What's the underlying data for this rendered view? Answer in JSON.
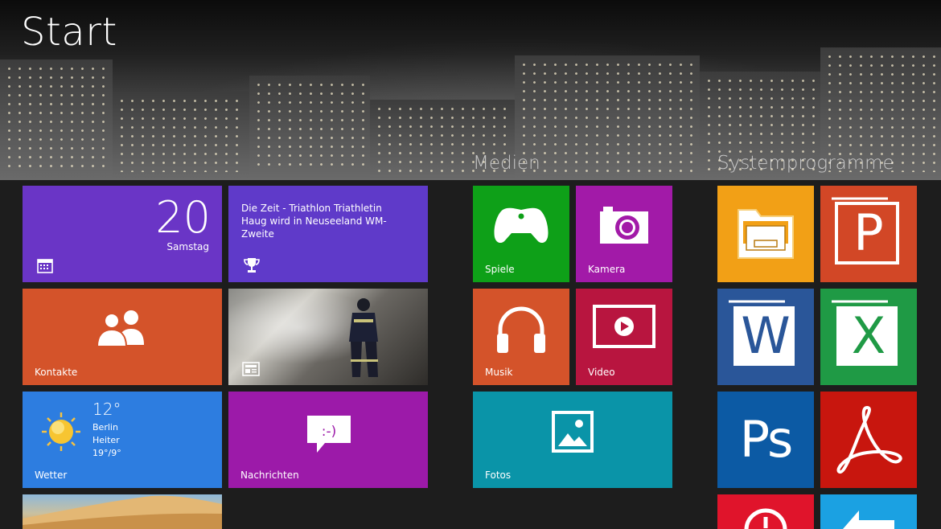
{
  "title": "Start",
  "groups": {
    "media": "Medien",
    "system": "Systemprogramme"
  },
  "tiles": {
    "calendar": {
      "day": "20",
      "weekday": "Samstag",
      "color": "#6a35c6"
    },
    "news_headline": "Die Zeit - Triathlon Triathletin Haug wird in Neuseeland WM-Zweite",
    "people": "Kontakte",
    "weather": {
      "label": "Wetter",
      "temp": "12°",
      "city": "Berlin",
      "cond": "Heiter",
      "range": "19°/9°"
    },
    "messaging": "Nachrichten",
    "games": "Spiele",
    "camera": "Kamera",
    "music": "Musik",
    "video": "Video",
    "photos": "Fotos",
    "powerpoint": "P",
    "word": "W",
    "excel": "X",
    "photoshop": "Ps"
  },
  "icons": {
    "calendar": "calendar-icon",
    "trophy": "trophy-icon",
    "people": "people-icon",
    "news": "newspaper-icon",
    "sun": "sun-icon",
    "chat": "chat-icon",
    "xbox": "xbox-controller-icon",
    "camera": "camera-icon",
    "headphones": "headphones-icon",
    "video": "video-icon",
    "photo": "photo-icon",
    "explorer": "file-explorer-icon",
    "acrobat": "acrobat-icon"
  }
}
